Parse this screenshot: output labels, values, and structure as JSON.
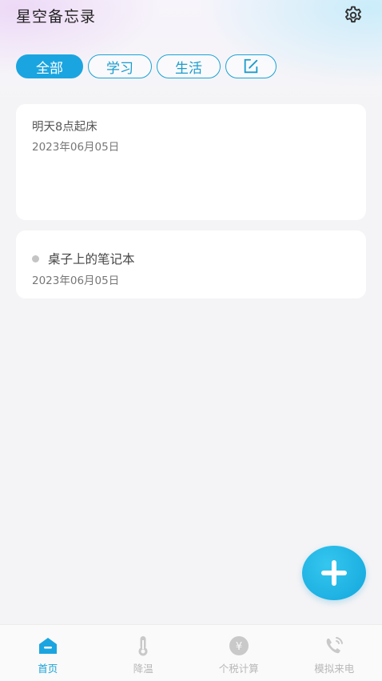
{
  "app": {
    "title": "星空备忘录"
  },
  "tabs": [
    {
      "label": "全部",
      "active": true
    },
    {
      "label": "学习",
      "active": false
    },
    {
      "label": "生活",
      "active": false
    }
  ],
  "notes": [
    {
      "title": "明天8点起床",
      "date": "2023年06月05日"
    },
    {
      "title": "桌子上的笔记本",
      "date": "2023年06月05日"
    }
  ],
  "bottom_nav": [
    {
      "label": "首页",
      "icon": "home-icon",
      "active": true
    },
    {
      "label": "降温",
      "icon": "thermometer-icon",
      "active": false
    },
    {
      "label": "个税计算",
      "icon": "tax-icon",
      "active": false
    },
    {
      "label": "模拟来电",
      "icon": "phone-icon",
      "active": false
    }
  ],
  "icons": {
    "settings": "gear-icon",
    "edit_tab": "edit-icon",
    "fab": "plus-icon"
  },
  "colors": {
    "accent": "#1ba5e0",
    "inactive": "#b8b8b8"
  }
}
